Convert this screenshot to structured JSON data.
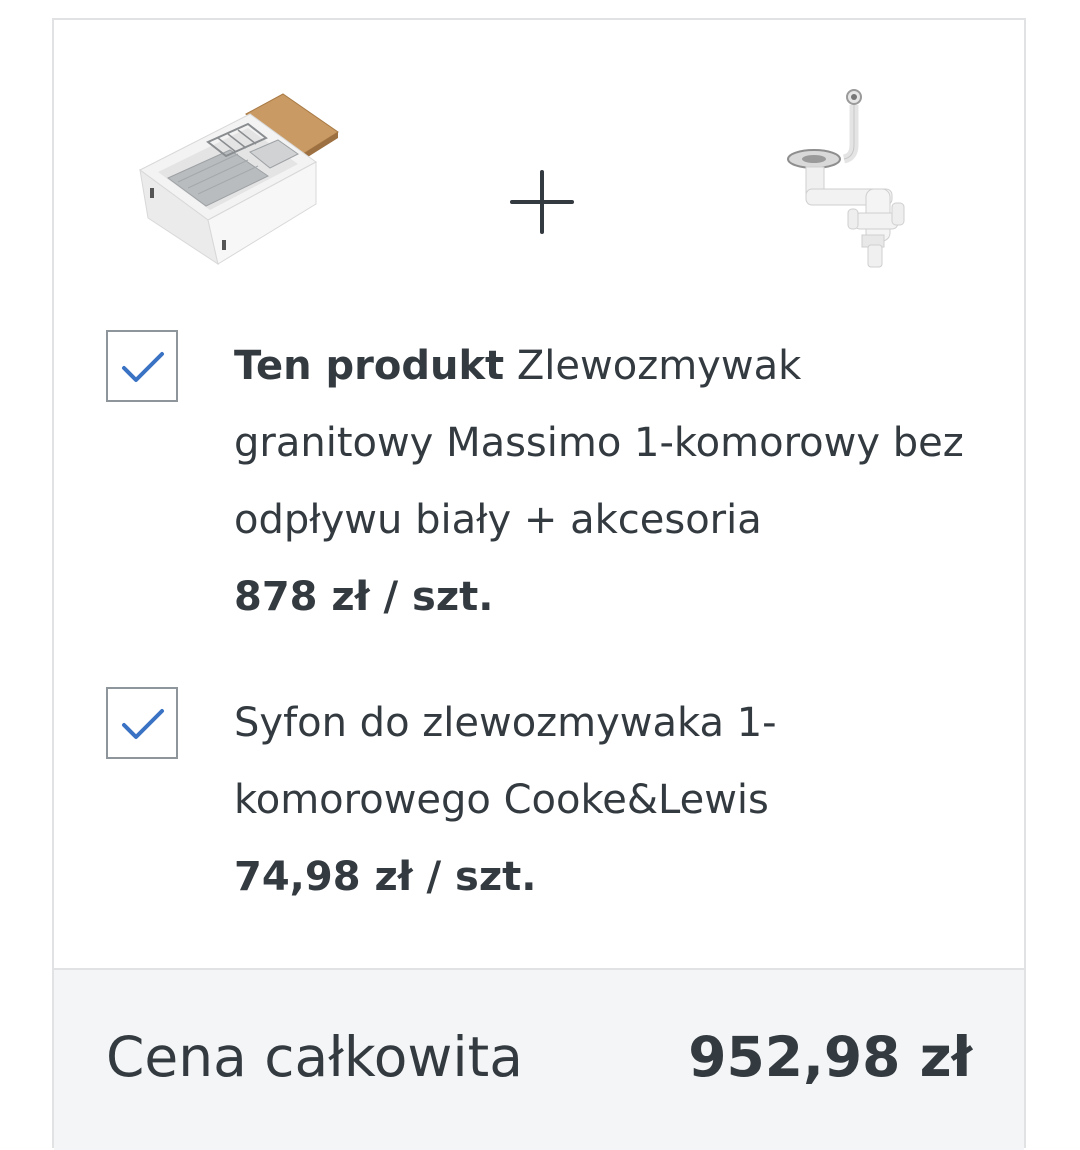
{
  "bundle": {
    "product_images": [
      {
        "icon": "granite-sink-image"
      },
      {
        "icon": "siphon-image"
      }
    ],
    "plus_icon": "plus-icon",
    "items": [
      {
        "checked": true,
        "prefix": "Ten produkt",
        "name": " Zlewozmywak granitowy Massimo 1-komorowy bez odpływu biały + akcesoria",
        "price": "878 zł / szt."
      },
      {
        "checked": true,
        "prefix": "",
        "name": "Syfon do zlewozmywaka 1-komorowego Cooke&Lewis",
        "price": "74,98 zł / szt."
      }
    ],
    "total": {
      "label": "Cena całkowita",
      "value": "952,98 zł"
    }
  },
  "colors": {
    "text": "#333a40",
    "checkmark": "#3a72c4",
    "border": "#e0e2e4",
    "total_background": "#f4f5f6"
  }
}
